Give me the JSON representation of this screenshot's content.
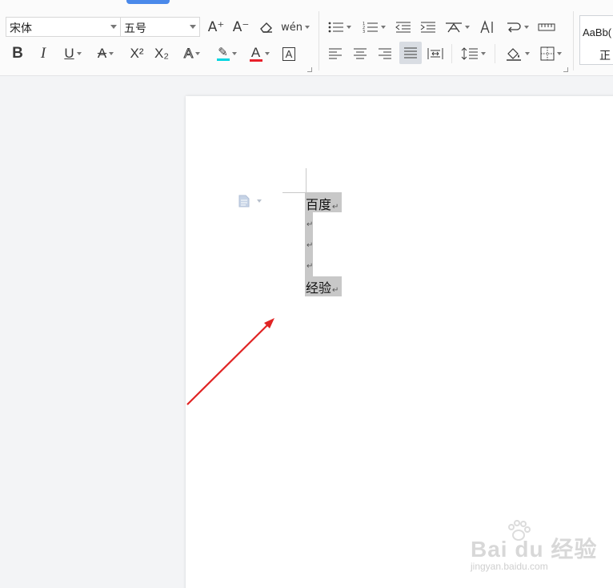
{
  "colors": {
    "accent_blue": "#4a89ea",
    "selection_gray": "#c8c8c8",
    "arrow_red": "#e02424",
    "highlight_cyan": "#00d5e0",
    "font_color_red": "#e8202a"
  },
  "ribbon": {
    "font_name": "宋体",
    "font_size": "五号",
    "tools": {
      "grow_font": "A⁺",
      "shrink_font": "A⁻",
      "clear_format": "⌫",
      "phonetic": "wén",
      "bold": "B",
      "italic": "I",
      "underline": "U",
      "strikethrough": "A",
      "superscript": "X²",
      "subscript": "X₂",
      "text_effect": "A",
      "highlight": "✎",
      "font_color": "A",
      "char_border": "A"
    },
    "style_gallery": {
      "sample": "AaBb(",
      "name": "正"
    }
  },
  "document": {
    "lines": [
      {
        "text": "百度",
        "mark": "↵"
      },
      {
        "text": "",
        "mark": "↵"
      },
      {
        "text": "",
        "mark": "↵"
      },
      {
        "text": "",
        "mark": "↵"
      },
      {
        "text": "经验",
        "mark": "↵"
      }
    ]
  },
  "watermark": {
    "brand": "Bai du 经验",
    "url": "jingyan.baidu.com"
  }
}
